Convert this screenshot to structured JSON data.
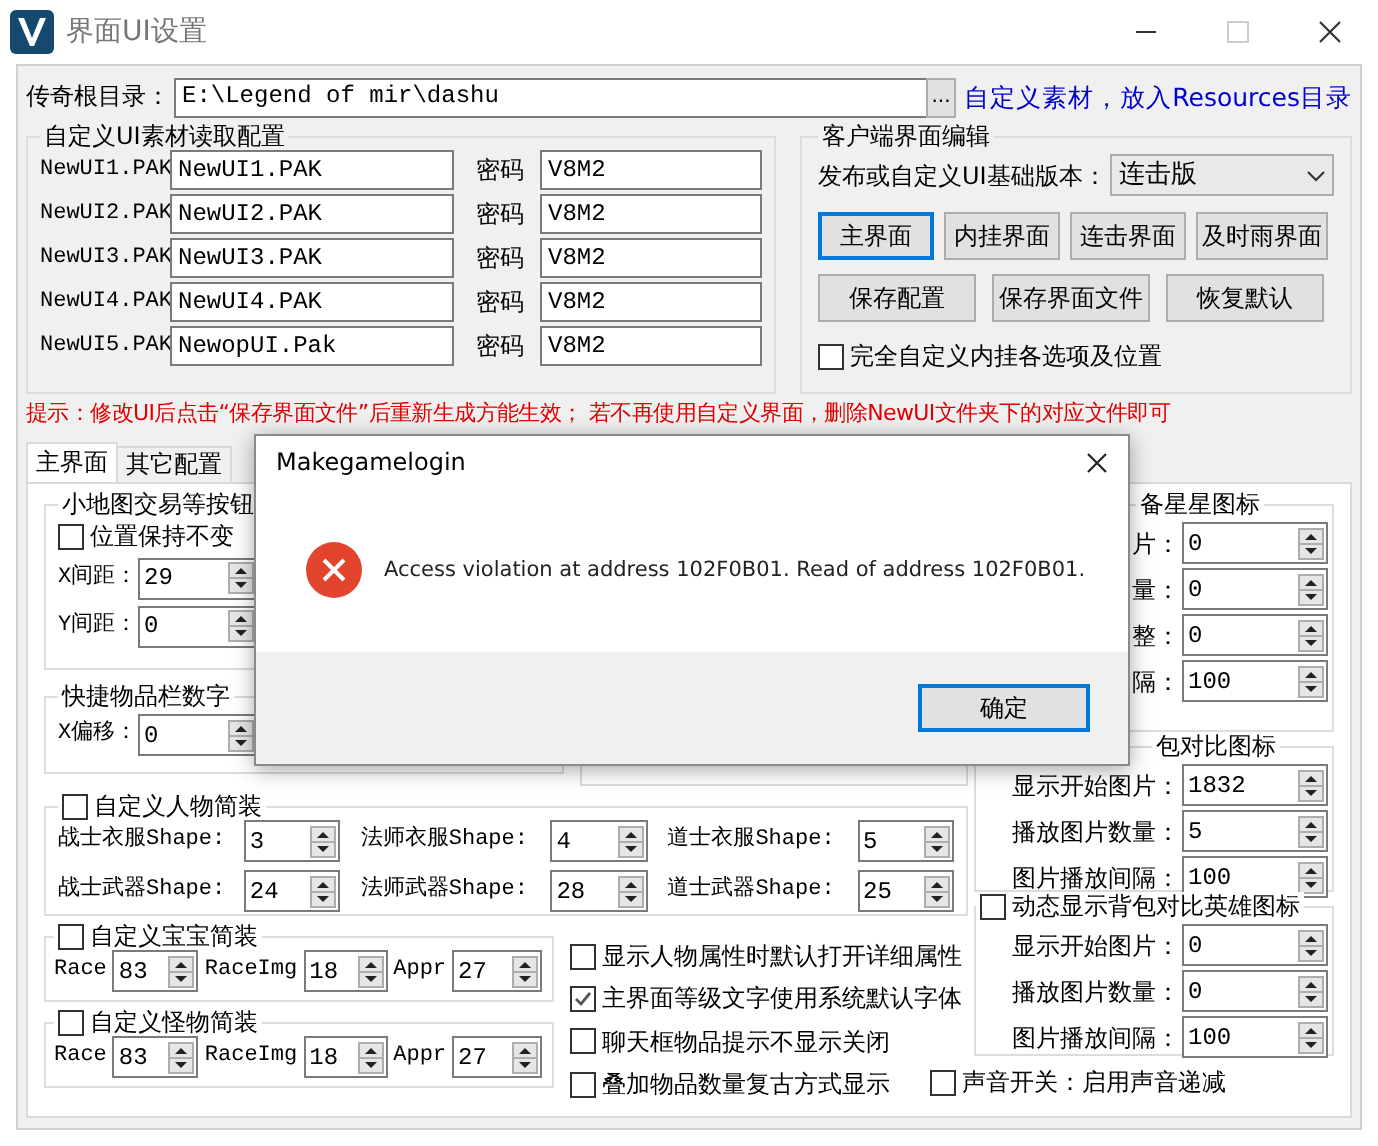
{
  "window": {
    "title": "界面UI设置"
  },
  "root_dir": {
    "label": "传奇根目录：",
    "value": "E:\\Legend of mir\\dashu",
    "browse": "...",
    "link": "自定义素材，放入Resources目录"
  },
  "ui_assets": {
    "title": "自定义UI素材读取配置",
    "rows": [
      {
        "label": "NewUI1.PAK",
        "file": "NewUI1.PAK",
        "password_label": "密码",
        "password": "V8M2"
      },
      {
        "label": "NewUI2.PAK",
        "file": "NewUI2.PAK",
        "password_label": "密码",
        "password": "V8M2"
      },
      {
        "label": "NewUI3.PAK",
        "file": "NewUI3.PAK",
        "password_label": "密码",
        "password": "V8M2"
      },
      {
        "label": "NewUI4.PAK",
        "file": "NewUI4.PAK",
        "password_label": "密码",
        "password": "V8M2"
      },
      {
        "label": "NewUI5.PAK",
        "file": "NewopUI.Pak",
        "password_label": "密码",
        "password": "V8M2"
      }
    ]
  },
  "client_edit": {
    "title": "客户端界面编辑",
    "version_label": "发布或自定义UI基础版本：",
    "version": "连击版",
    "buttons": [
      {
        "label": "主界面",
        "focused": true
      },
      {
        "label": "内挂界面",
        "focused": false
      },
      {
        "label": "连击界面",
        "focused": false
      },
      {
        "label": "及时雨界面",
        "focused": false
      }
    ],
    "buttons_2": [
      {
        "label": "保存配置",
        "focused": false
      },
      {
        "label": "保存界面文件",
        "focused": false
      },
      {
        "label": "恢复默认",
        "focused": false
      }
    ],
    "full_custom": {
      "label": "完全自定义内挂各选项及位置",
      "checked": false
    }
  },
  "hint": "提示：修改UI后点击“保存界面文件”后重新生成方能生效；  若不再使用自定义界面，删除NewUI文件夹下的对应文件即可",
  "tabs": [
    {
      "label": "主界面",
      "selected": true
    },
    {
      "label": "其它配置",
      "selected": false
    }
  ],
  "main_tab": {
    "minimap_group": {
      "title": "小地图交易等按钮",
      "keep_position": {
        "label": "位置保持不变",
        "checked": false
      },
      "fields": [
        {
          "label": "X间距：",
          "value": "29"
        },
        {
          "label": "Y间距：",
          "value": "0"
        }
      ]
    },
    "hotbar_group": {
      "title": "快捷物品栏数字",
      "fields": [
        {
          "label": "X偏移：",
          "value": "0"
        }
      ]
    },
    "star_group": {
      "title": "备星星图标",
      "fields": [
        {
          "label": "片：",
          "value": "0"
        },
        {
          "label": "量：",
          "value": "0"
        },
        {
          "label": "整：",
          "value": "0"
        },
        {
          "label": "隔：",
          "value": "100"
        }
      ]
    },
    "bag_compare_group": {
      "title": "包对比图标",
      "fields": [
        {
          "label": "显示开始图片：",
          "value": "1832"
        },
        {
          "label": "播放图片数量：",
          "value": "5"
        },
        {
          "label": "图片播放间隔：",
          "value": "100"
        }
      ]
    },
    "hero_compare_group": {
      "title": "动态显示背包对比英雄图标",
      "checked": false,
      "fields": [
        {
          "label": "显示开始图片：",
          "value": "0"
        },
        {
          "label": "播放图片数量：",
          "value": "0"
        },
        {
          "label": "图片播放间隔：",
          "value": "100"
        }
      ]
    },
    "player_group": {
      "title": "自定义人物简装",
      "checked": false,
      "fields": [
        {
          "label": "战士衣服Shape:",
          "value": "3"
        },
        {
          "label": "法师衣服Shape:",
          "value": "4"
        },
        {
          "label": "道士衣服Shape:",
          "value": "5"
        },
        {
          "label": "战士武器Shape:",
          "value": "24"
        },
        {
          "label": "法师武器Shape:",
          "value": "28"
        },
        {
          "label": "道士武器Shape:",
          "value": "25"
        }
      ]
    },
    "pet_group": {
      "title": "自定义宝宝简装",
      "checked": false,
      "fields": [
        {
          "label": "Race",
          "value": "83"
        },
        {
          "label": "RaceImg",
          "value": "18"
        },
        {
          "label": "Appr",
          "value": "27"
        }
      ]
    },
    "monster_group": {
      "title": "自定义怪物简装",
      "checked": false,
      "fields": [
        {
          "label": "Race",
          "value": "83"
        },
        {
          "label": "RaceImg",
          "value": "18"
        },
        {
          "label": "Appr",
          "value": "27"
        }
      ]
    },
    "options": [
      {
        "label": "显示人物属性时默认打开详细属性",
        "checked": false
      },
      {
        "label": "主界面等级文字使用系统默认字体",
        "checked": true
      },
      {
        "label": "聊天框物品提示不显示关闭",
        "checked": false
      },
      {
        "label": "叠加物品数量复古方式显示",
        "checked": false
      }
    ],
    "sound": {
      "label": "声音开关：启用声音递减",
      "checked": false
    }
  },
  "dialog": {
    "title": "Makegamelogin",
    "message": "Access violation at address 102F0B01. Read of address 102F0B01.",
    "button": "确定"
  }
}
